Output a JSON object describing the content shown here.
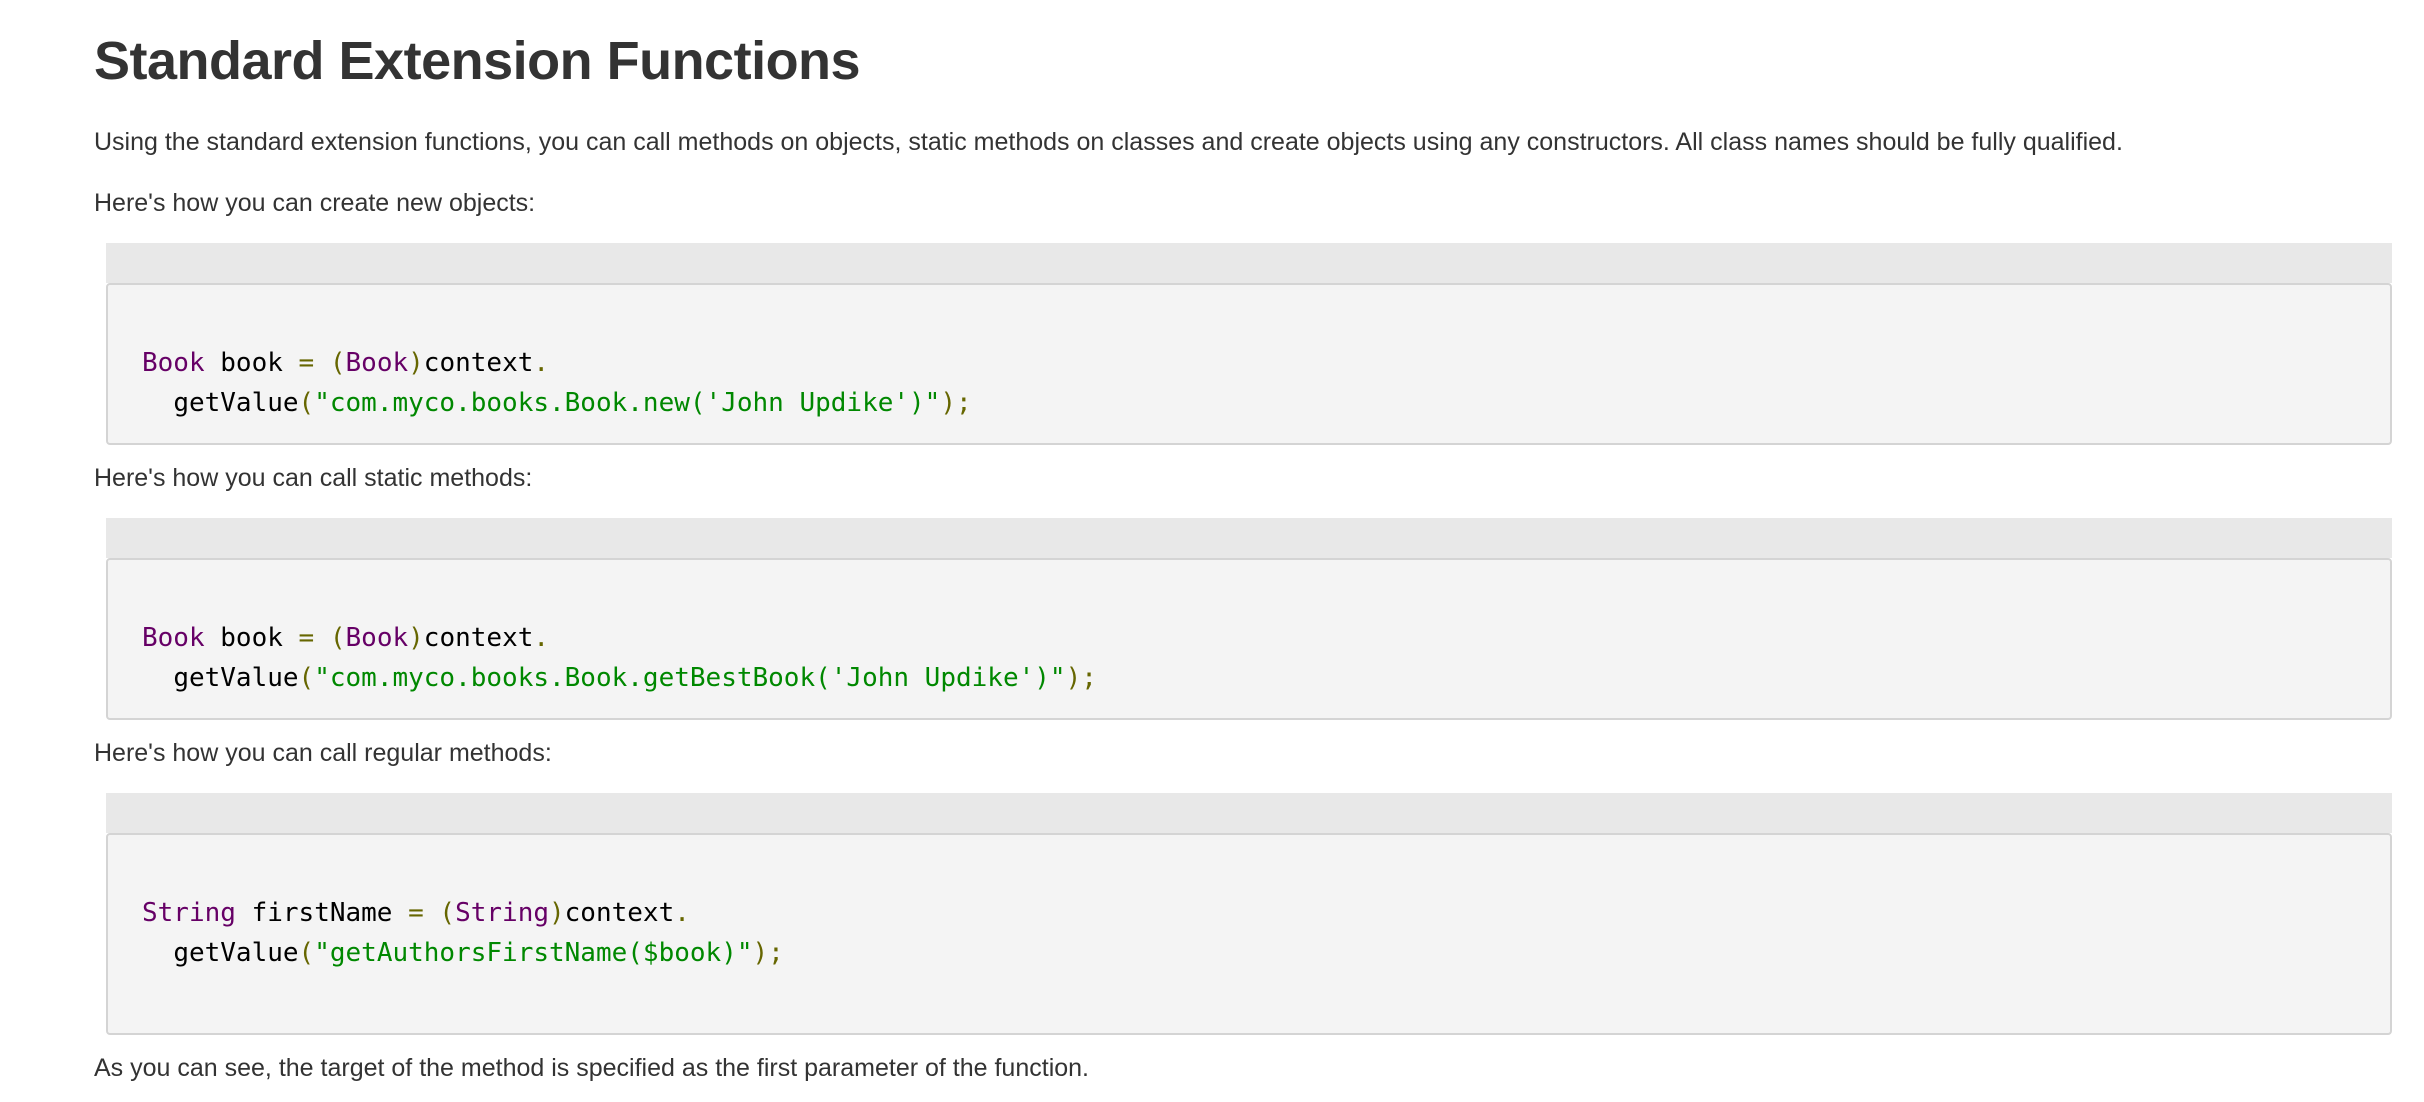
{
  "title": "Standard Extension Functions",
  "intro": "Using the standard extension functions, you can call methods on objects, static methods on classes and create objects using any constructors. All class names should be fully qualified.",
  "sections": [
    {
      "caption": "Here's how you can create new objects:",
      "line1": {
        "type": "Book",
        "var": " book ",
        "eq": "=",
        "sp": " ",
        "lp": "(",
        "cast": "Book",
        "rp": ")",
        "obj": "context",
        "dot": "."
      },
      "line2": {
        "indent": "  ",
        "method": "getValue",
        "lp": "(",
        "str": "\"com.myco.books.Book.new('John Updike')\"",
        "end": ");"
      }
    },
    {
      "caption": "Here's how you can call static methods:",
      "line1": {
        "type": "Book",
        "var": " book ",
        "eq": "=",
        "sp": " ",
        "lp": "(",
        "cast": "Book",
        "rp": ")",
        "obj": "context",
        "dot": "."
      },
      "line2": {
        "indent": "  ",
        "method": "getValue",
        "lp": "(",
        "str": "\"com.myco.books.Book.getBestBook('John Updike')\"",
        "end": ");"
      }
    },
    {
      "caption": "Here's how you can call regular methods:",
      "line1": {
        "type": "String",
        "var": " firstName ",
        "eq": "=",
        "sp": " ",
        "lp": "(",
        "cast": "String",
        "rp": ")",
        "obj": "context",
        "dot": "."
      },
      "line2": {
        "indent": "  ",
        "method": "getValue",
        "lp": "(",
        "str": "\"getAuthorsFirstName($book)\"",
        "end": ");"
      }
    }
  ],
  "outro": "As you can see, the target of the method is specified as the first parameter of the function."
}
